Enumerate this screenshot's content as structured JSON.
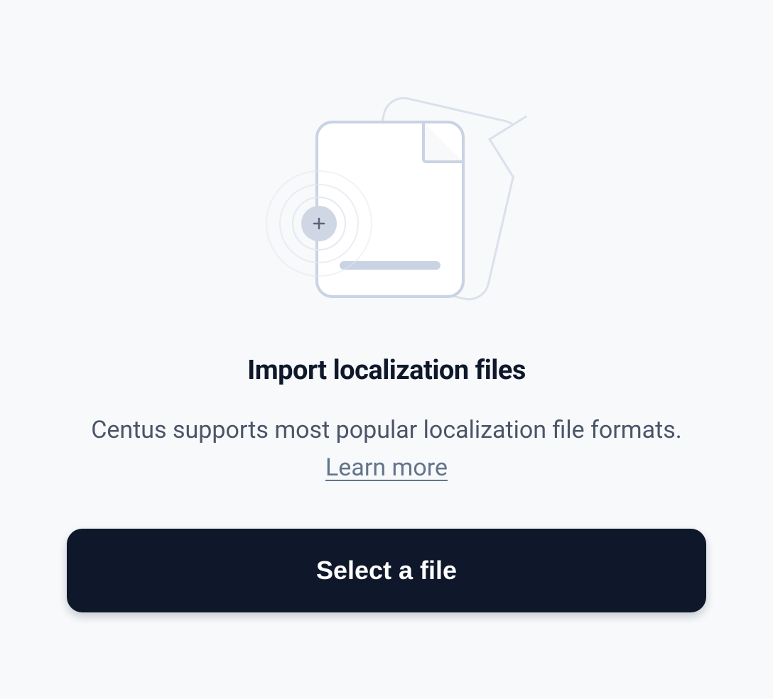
{
  "import": {
    "heading": "Import localization files",
    "description_prefix": "Centus supports most popular localization file formats. ",
    "learn_more_label": "Learn more",
    "select_button_label": "Select a file"
  }
}
